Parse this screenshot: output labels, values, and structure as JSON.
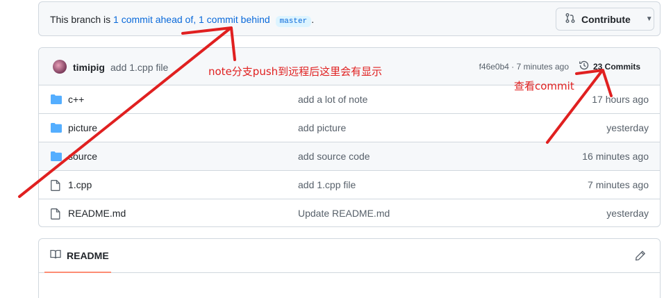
{
  "branch": {
    "prefix": "This branch is ",
    "link_text": "1 commit ahead of, 1 commit behind",
    "base_branch": "master",
    "suffix": ".",
    "contribute_label": "Contribute"
  },
  "commit": {
    "author": "timipig",
    "message": "add 1.cpp file",
    "meta": "f46e0b4 · 7 minutes ago",
    "commits_count": "23 Commits"
  },
  "files": [
    {
      "type": "dir",
      "name": "c++",
      "message": "add a lot of note",
      "age": "17 hours ago"
    },
    {
      "type": "dir",
      "name": "picture",
      "message": "add picture",
      "age": "yesterday"
    },
    {
      "type": "dir",
      "name": "source",
      "message": "add source code",
      "age": "16 minutes ago"
    },
    {
      "type": "file",
      "name": "1.cpp",
      "message": "add 1.cpp file",
      "age": "7 minutes ago"
    },
    {
      "type": "file",
      "name": "README.md",
      "message": "Update README.md",
      "age": "yesterday"
    }
  ],
  "readme": {
    "tab_label": "README"
  },
  "annotations": {
    "push_note": "note分支push到远程后这里会有显示",
    "commit_note": "查看commit",
    "color": "#e02020"
  },
  "colors": {
    "link": "#0969da",
    "border": "#d0d7de",
    "header_bg": "#f6f8fa",
    "folder": "#54aeff",
    "tab_underline": "#fd8c73"
  }
}
